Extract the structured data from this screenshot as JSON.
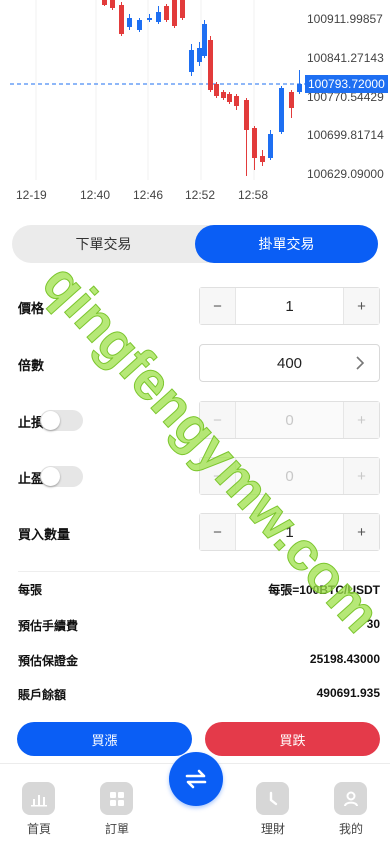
{
  "chart": {
    "price_ticks": [
      "100911.99857",
      "100841.27143",
      "100770.54429",
      "100699.81714",
      "100629.09000"
    ],
    "current_price": "100793.72000",
    "time_ticks": [
      "12-19",
      "12:40",
      "12:46",
      "12:52",
      "12:58"
    ],
    "colors": {
      "up": "#1e6ff2",
      "down": "#e23b3b",
      "current_line": "#1e6ff2"
    }
  },
  "tabs": {
    "market": "下單交易",
    "limit": "掛單交易",
    "active": "limit"
  },
  "form": {
    "price": {
      "label": "價格",
      "value": "1",
      "minus": "−",
      "plus": "+"
    },
    "multiple": {
      "label": "倍數",
      "value": "400"
    },
    "stop_loss": {
      "label": "止損",
      "value": "0",
      "enabled": false,
      "minus": "−",
      "plus": "+"
    },
    "take_profit": {
      "label": "止盈",
      "value": "0",
      "enabled": false,
      "minus": "−",
      "plus": "+"
    },
    "quantity": {
      "label": "買入數量",
      "value": "1",
      "minus": "−",
      "plus": "+"
    }
  },
  "info": {
    "per_lot": {
      "label": "每張",
      "value": "每張=100BTC/USDT"
    },
    "fee": {
      "label": "預估手續費",
      "value": "30"
    },
    "margin": {
      "label": "預估保證金",
      "value": "25198.43000"
    },
    "balance": {
      "label": "賬戶餘額",
      "value": "490691.935"
    }
  },
  "actions": {
    "buy_up": "買漲",
    "buy_down": "買跌"
  },
  "nav": {
    "items": [
      {
        "label": "首頁",
        "icon": "chart-icon"
      },
      {
        "label": "訂單",
        "icon": "grid-icon"
      },
      {
        "label": "理財",
        "icon": "clock-icon"
      },
      {
        "label": "我的",
        "icon": "user-icon"
      }
    ],
    "center_icon": "swap-icon"
  },
  "watermark": "qingfengymw.com"
}
